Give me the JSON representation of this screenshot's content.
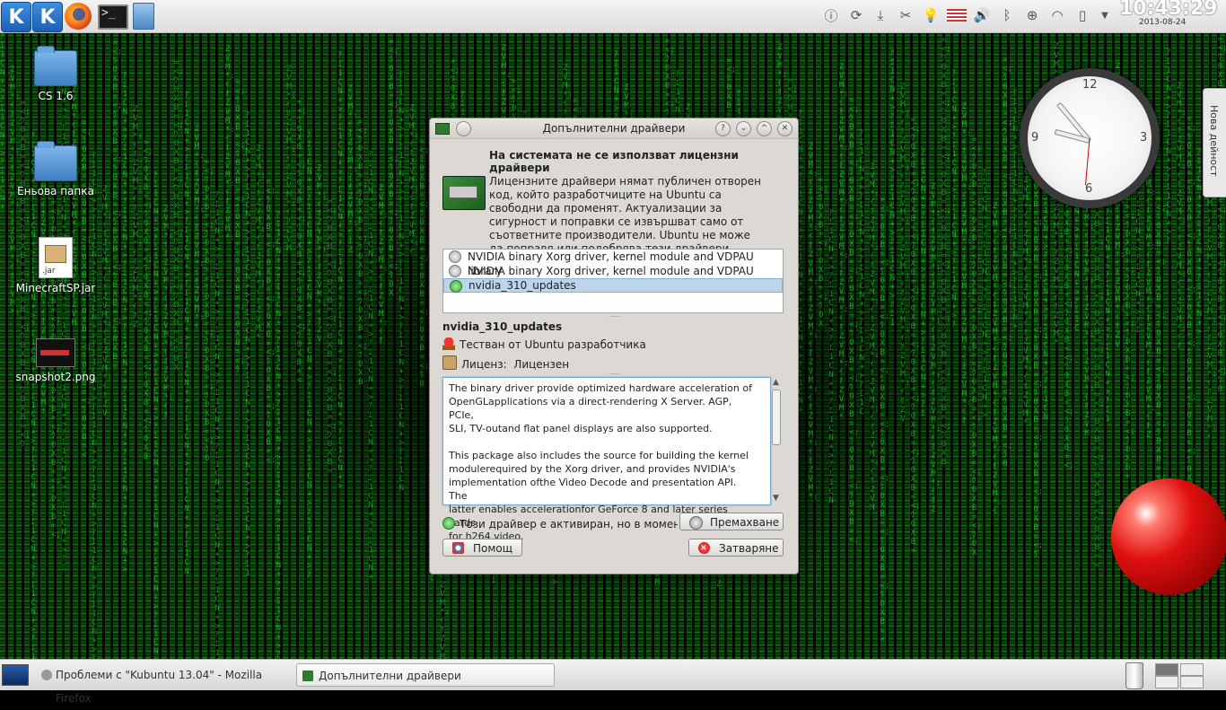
{
  "top_panel": {
    "launchers": [
      "kde-menu-icon",
      "kde-icon",
      "firefox-icon",
      "terminal-icon",
      "file-manager-icon"
    ],
    "tray_icons": [
      "info-icon",
      "update-icon",
      "download-icon",
      "scissors-icon",
      "bulb-icon",
      "us-flag-icon",
      "volume-icon",
      "bluetooth-icon",
      "network-icon",
      "wifi-icon",
      "battery-icon",
      "chevron-down-icon"
    ],
    "clock_time": "10:43:29",
    "clock_date": "2013-08-24"
  },
  "desktop": {
    "icons": [
      {
        "label": "CS 1.6",
        "type": "folder"
      },
      {
        "label": "Еньова папка",
        "type": "folder"
      },
      {
        "label": "MinecraftSP.jar",
        "type": "jar",
        "badge": ".jar"
      },
      {
        "label": "snapshot2.png",
        "type": "image"
      }
    ],
    "clock_numbers": [
      "12",
      "3",
      "6",
      "9"
    ],
    "side_tab_label": "Нова дейност"
  },
  "dialog": {
    "title": "Допълнителни драйвери",
    "title_buttons": [
      "?",
      "⌄",
      "^",
      "✕"
    ],
    "headline": "На системата не се използват лицензни драйвери",
    "description": "Лицензните драйвери нямат публичен отворен код, който разработчиците на Ubuntu са свободни да променят. Актуализации за сигурност и поправки се извършват само от съответните производители. Ubuntu не може да поправя или подобрява тези драйвери.",
    "drivers": [
      {
        "name": "NVIDIA binary Xorg driver, kernel module and VDPAU library",
        "active": false,
        "selected": false
      },
      {
        "name": "NVIDIA binary Xorg driver, kernel module and VDPAU library",
        "active": false,
        "selected": false
      },
      {
        "name": "nvidia_310_updates",
        "active": true,
        "selected": true
      }
    ],
    "selected_name": "nvidia_310_updates",
    "tested_label": "Тестван от Ubuntu разработчика",
    "license_label": "Лиценз:",
    "license_value": "Лицензен",
    "details": "The binary driver provide optimized hardware acceleration of\nOpenGLapplications via a direct-rendering X Server. AGP, PCIe,\nSLI, TV-outand flat panel displays are also supported.\n\nThis package also includes the source for building the kernel\nmodulerequired by the Xorg driver, and provides NVIDIA's\nimplementation ofthe Video Decode and presentation API. The\nlatter enables accelerationfor GeForce 8 and later series cards\nfor h264 video.",
    "status_text": "Този драйвер е активиран, но в момента н",
    "remove_button": "Премахване",
    "help_button": "Помощ",
    "close_button": "Затваряне"
  },
  "taskbar": {
    "tasks": [
      {
        "label": "Проблеми с \"Kubuntu 13.04\" - Mozilla Firefox",
        "active": false
      },
      {
        "label": "Допълнителни драйвери",
        "active": true
      }
    ]
  }
}
